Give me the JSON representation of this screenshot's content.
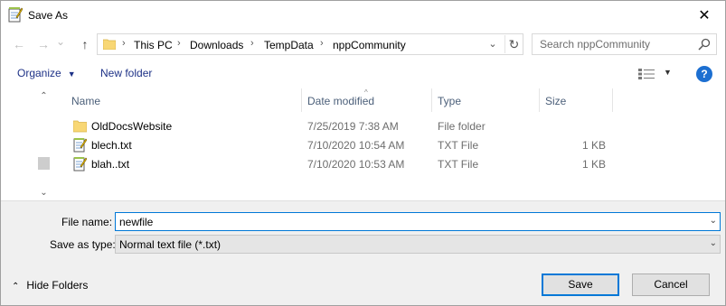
{
  "window": {
    "title": "Save As",
    "close_glyph": "✕"
  },
  "nav": {
    "back_glyph": "←",
    "forward_glyph": "→",
    "recent_glyph": "⌄",
    "up_glyph": "↑",
    "breadcrumb": [
      "This PC",
      "Downloads",
      "TempData",
      "nppCommunity"
    ],
    "separator": "›",
    "dropdown_glyph": "⌄",
    "refresh_glyph": "↻",
    "search_placeholder": "Search nppCommunity"
  },
  "toolbar": {
    "organize_label": "Organize",
    "organize_caret": "▼",
    "new_folder_label": "New folder",
    "view_caret": "▼",
    "help_label": "?"
  },
  "scrollbar": {
    "up_glyph": "⌃",
    "down_glyph": "⌄"
  },
  "columns": {
    "name": "Name",
    "date": "Date modified",
    "type": "Type",
    "size": "Size",
    "sort_glyph": "^"
  },
  "files": [
    {
      "name": "OldDocsWebsite",
      "date": "7/25/2019 7:38 AM",
      "type": "File folder",
      "size": "",
      "icon": "folder-icon"
    },
    {
      "name": "blech.txt",
      "date": "7/10/2020 10:54 AM",
      "type": "TXT File",
      "size": "1 KB",
      "icon": "notepad-file-icon"
    },
    {
      "name": "blah..txt",
      "date": "7/10/2020 10:53 AM",
      "type": "TXT File",
      "size": "1 KB",
      "icon": "notepad-file-icon"
    }
  ],
  "form": {
    "file_name_label": "File name:",
    "file_name_value": "newfile",
    "save_type_label": "Save as type:",
    "save_type_value": "Normal text file (*.txt)",
    "dropdown_glyph": "⌄"
  },
  "footer": {
    "hide_folders_label": "Hide Folders",
    "hide_caret": "⌃",
    "save_label": "Save",
    "cancel_label": "Cancel"
  },
  "colors": {
    "accent": "#0078d7",
    "link": "#1e3287",
    "folder": "#f8d775",
    "help": "#1c6fd1"
  }
}
